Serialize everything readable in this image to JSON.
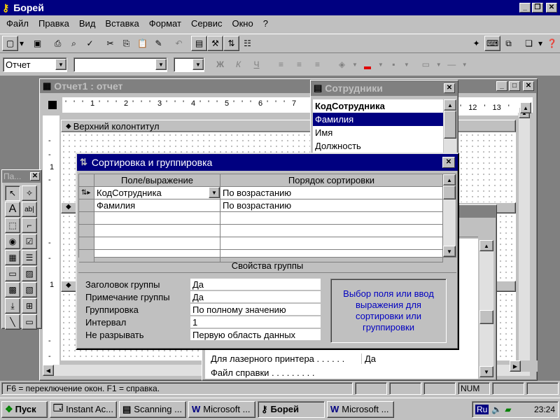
{
  "app": {
    "title": "Борей"
  },
  "menu": [
    "Файл",
    "Правка",
    "Вид",
    "Вставка",
    "Формат",
    "Сервис",
    "Окно",
    "?"
  ],
  "format_bar": {
    "object_select": "Отчет",
    "font_select": "",
    "size_select": "",
    "bold": "Ж",
    "italic": "К",
    "underline": "Ч"
  },
  "report_window": {
    "title": "Отчет1 : отчет",
    "ruler": [
      "1",
      "2",
      "3",
      "4",
      "5",
      "6",
      "7"
    ],
    "ruler_right": [
      "12",
      "13"
    ],
    "page_header": "Верхний колонтитул"
  },
  "fields_window": {
    "title": "Сотрудники",
    "items": [
      "КодСотрудника",
      "Фамилия",
      "Имя",
      "Должность"
    ]
  },
  "toolbox": {
    "title": "Па..."
  },
  "sorting_dialog": {
    "title": "Сортировка и группировка",
    "col_field": "Поле/выражение",
    "col_order": "Порядок сортировки",
    "rows": [
      {
        "field": "КодСотрудника",
        "order": "По возрастанию"
      },
      {
        "field": "Фамилия",
        "order": "По возрастанию"
      }
    ],
    "group_props_title": "Свойства группы",
    "props": [
      {
        "label": "Заголовок группы",
        "value": "Да"
      },
      {
        "label": "Примечание группы",
        "value": "Да"
      },
      {
        "label": "Группировка",
        "value": "По полному значению"
      },
      {
        "label": "Интервал",
        "value": "1"
      },
      {
        "label": "Не разрывать",
        "value": "Первую область данных"
      }
    ],
    "hint": "Выбор поля или ввод выражения для сортировки или группировки"
  },
  "behind_props": [
    {
      "label": "Для лазерного принтера . . . . . .",
      "value": "Да"
    },
    {
      "label": "Файл справки . . . . . . . . .",
      "value": ""
    }
  ],
  "status": {
    "text": "F6 = переключение окон.  F1 = справка.",
    "num": "NUM"
  },
  "taskbar": {
    "start": "Пуск",
    "buttons": [
      "Instant Ac...",
      "Scanning ...",
      "Microsoft ...",
      "Борей",
      "Microsoft ..."
    ],
    "lang": "Ru",
    "time": "23:24"
  },
  "colors": {
    "titlebar": "#000080",
    "desktop": "#c0c0c0",
    "hint_text": "#0000c0"
  }
}
